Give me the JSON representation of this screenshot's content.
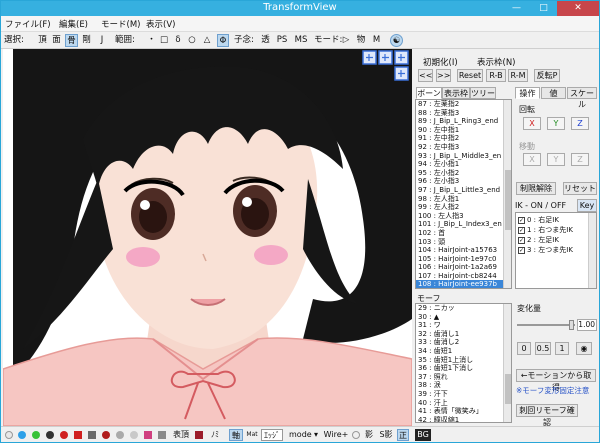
{
  "window": {
    "title": "TransformView"
  },
  "menubar": [
    "ファイル(F)",
    "編集(E)",
    "モード(M)",
    "表示(V)"
  ],
  "toolbar": {
    "select_label": "選択:",
    "items": [
      "頂",
      "面",
      "骨",
      "剛",
      "J"
    ],
    "range_label": "範囲:",
    "range_items": [
      "・",
      "□",
      "δ",
      "○",
      "△",
      "Φ"
    ],
    "subkey_label": "子念:",
    "subkey_items": [
      "透",
      "PS",
      "MS"
    ],
    "mode_label": "モード:",
    "mode_items": [
      "▷",
      "物",
      "M"
    ]
  },
  "panel": {
    "init_label": "初期化(I)",
    "display_label": "表示枠(N)",
    "nav_prev": "<<",
    "nav_next": ">>",
    "reset": "Reset",
    "rb": "R-B",
    "rm": "R-M",
    "flip": "反転P",
    "bone_tabs": [
      "ボーン",
      "表示枠",
      "ツリー"
    ],
    "bone_list": [
      "87 : 左薬指2",
      "88 : 左薬指3",
      "89 : J_Bip_L_Ring3_end",
      "90 : 左中指1",
      "91 : 左中指2",
      "92 : 左中指3",
      "93 : J_Bip_L_Middle3_en",
      "94 : 左小指1",
      "95 : 左小指2",
      "96 : 左小指3",
      "97 : J_Bip_L_Little3_end",
      "98 : 左人指1",
      "99 : 左人指2",
      "100 : 左人指3",
      "101 : J_Bip_L_Index3_en",
      "102 : 首",
      "103 : 頭",
      "104 : HairJoint-a15763",
      "105 : HairJoint-1e97c0",
      "106 : HairJoint-1a2a69",
      "107 : HairJoint-cb8244",
      "108 : HairJoint-ee937b"
    ],
    "bone_selected_index": 21,
    "op_tabs": [
      "操作",
      "値",
      "スケール"
    ],
    "rotate_label": "回転",
    "move_label": "移動",
    "x": "X",
    "y": "Y",
    "z": "Z",
    "ik_lock": "制限解除",
    "reset_btn": "リセット",
    "ik_label": "IK - ON / OFF",
    "key_btn": "Key",
    "ik_list": [
      "0 : 右足IK",
      "1 : 右つま先IK",
      "2 : 左足IK",
      "3 : 左つま先IK"
    ],
    "morph_label": "モーフ",
    "morph_list": [
      "29 : ニカッ",
      "30 : ▲",
      "31 : ワ",
      "32 : 歯消し1",
      "33 : 歯消し2",
      "34 : 歯短1",
      "35 : 歯短1上消し",
      "36 : 歯短1下消し",
      "37 : 照れ",
      "38 : 涙",
      "39 : 汗下",
      "40 : 汗上",
      "41 : 表情「微笑み」",
      "42 : 瞳収縮1",
      "42 : 瞳収縮2"
    ],
    "morph_selected_index": 14,
    "change_label": "変化量",
    "change_value": "1.00",
    "btn_0": "0",
    "btn_05": "0.5",
    "btn_1": "1",
    "from_motion": "←モーションから取得",
    "morph_note": "※モーフ変形固定注意",
    "morph_confirm": "刺回リモーフ確認"
  },
  "statusbar": {
    "items": [
      "表頂",
      "ﾉﾐ",
      "軸",
      "ｴｯｼﾞ",
      "mode",
      "Wire+",
      "影",
      "S影",
      "正"
    ],
    "bg": "BG"
  }
}
